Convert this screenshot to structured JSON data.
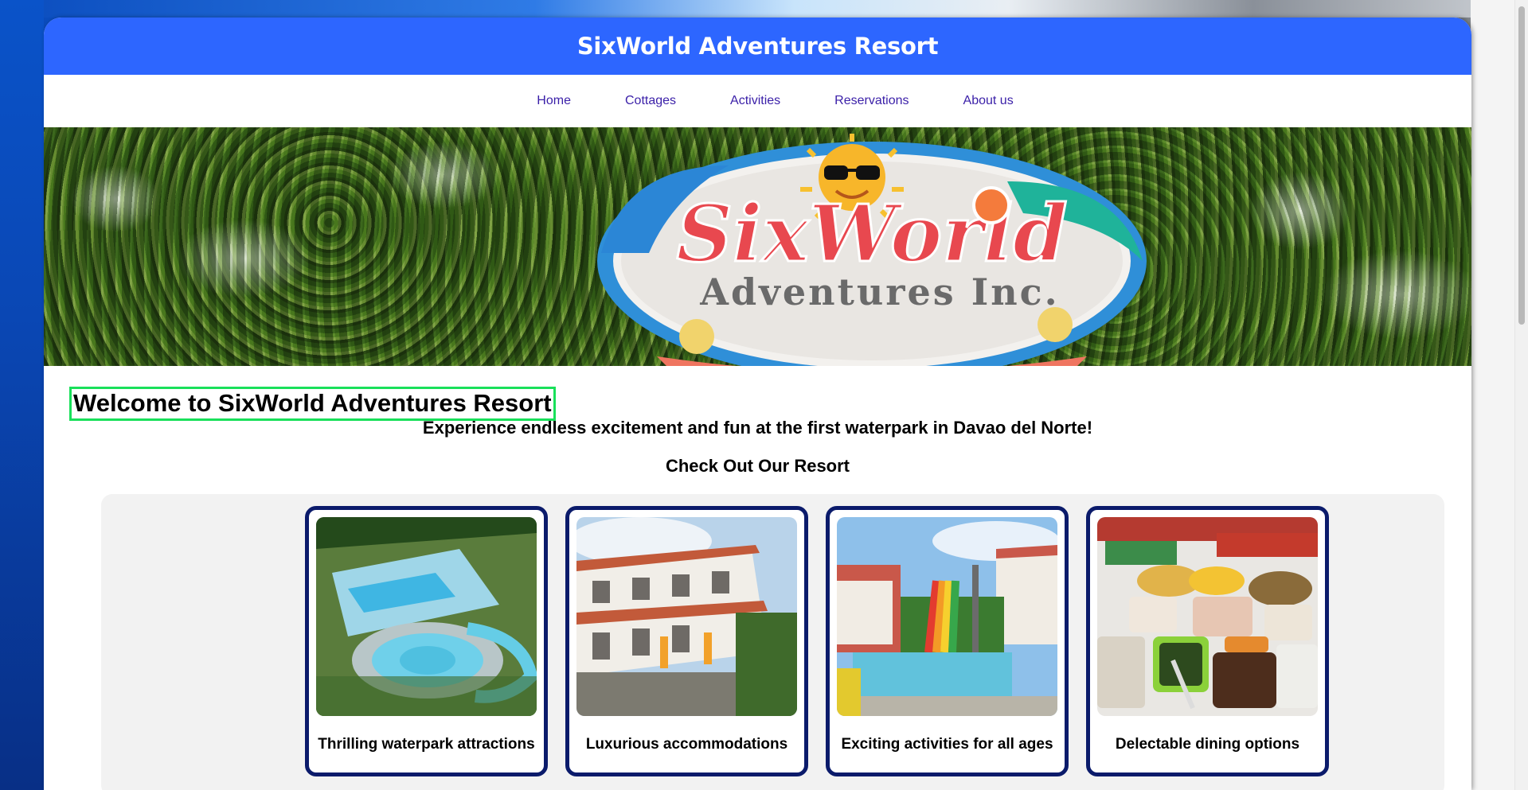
{
  "site": {
    "title": "SixWorld Adventures Resort"
  },
  "nav": {
    "items": [
      {
        "label": "Home"
      },
      {
        "label": "Cottages"
      },
      {
        "label": "Activities"
      },
      {
        "label": "Reservations"
      },
      {
        "label": "About us"
      }
    ]
  },
  "hero": {
    "sign_main": "SixWorld",
    "sign_sub": "Adventures Inc."
  },
  "main": {
    "welcome": "Welcome to SixWorld Adventures Resort",
    "tagline": "Experience endless excitement and fun at the first waterpark in Davao del Norte!",
    "section_title": "Check Out Our Resort"
  },
  "cards": [
    {
      "caption": "Thrilling waterpark attractions"
    },
    {
      "caption": "Luxurious accommodations"
    },
    {
      "caption": "Exciting activities for all ages"
    },
    {
      "caption": "Delectable dining options"
    }
  ],
  "colors": {
    "header_blue": "#2d66ff",
    "nav_link": "#3a1fa8",
    "card_border": "#0b1b6b",
    "focus_outline": "#19e05a"
  }
}
